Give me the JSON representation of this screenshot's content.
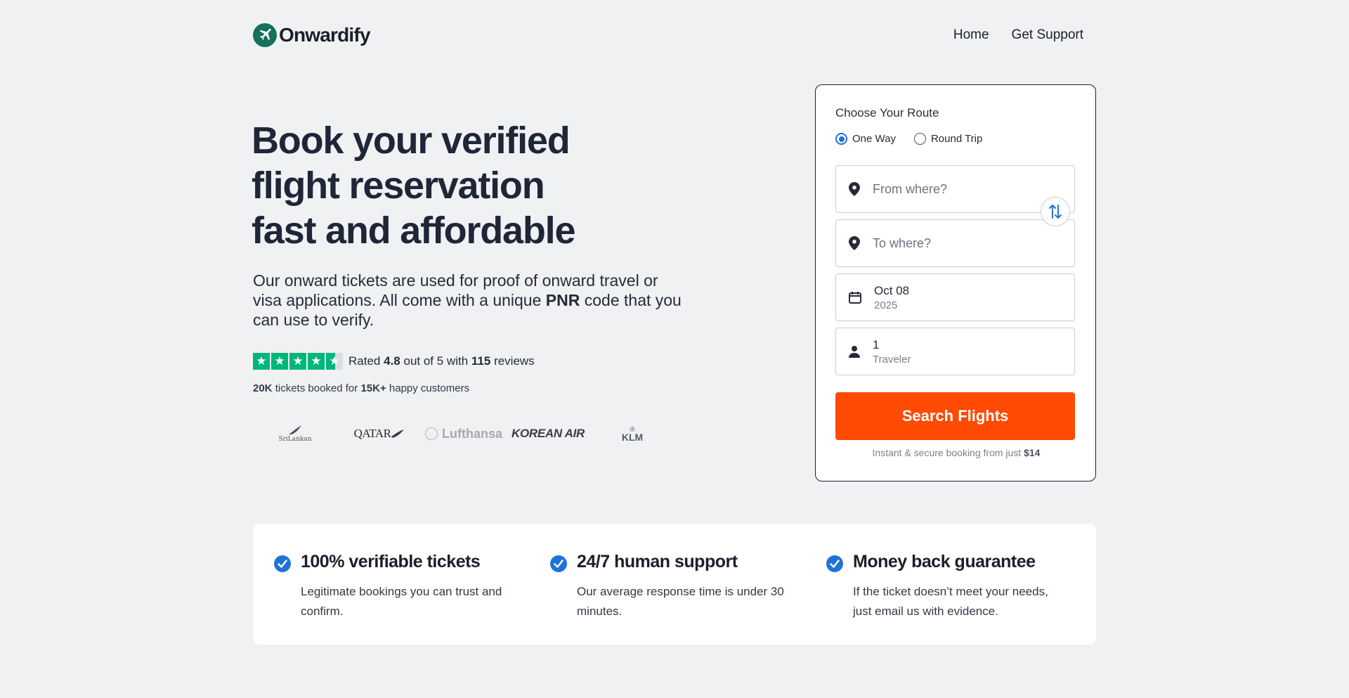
{
  "header": {
    "brand": "Onwardify",
    "nav": [
      {
        "label": "Home"
      },
      {
        "label": "Get Support"
      }
    ]
  },
  "hero": {
    "title_lines": [
      "Book your verified",
      "flight reservation",
      "fast and affordable"
    ],
    "subtitle_pre": "Our onward tickets are used for proof of onward travel or visa applications. All come with a unique ",
    "subtitle_bold": "PNR",
    "subtitle_post": " code that you can use to verify.",
    "rating": {
      "stars": 4.5,
      "prefix": "Rated",
      "score": "4.8",
      "middle": "out of 5 with",
      "count": "115",
      "suffix": "reviews"
    },
    "stats": {
      "tickets": "20K",
      "tickets_text": "tickets booked for",
      "customers": "15K+",
      "customers_text": "happy customers"
    },
    "airlines": [
      "SriLankan",
      "QATAR",
      "Lufthansa",
      "KOREAN AIR",
      "KLM"
    ]
  },
  "booking": {
    "title": "Choose Your Route",
    "trip_types": [
      {
        "label": "One Way",
        "selected": true
      },
      {
        "label": "Round Trip",
        "selected": false
      }
    ],
    "from_placeholder": "From where?",
    "to_placeholder": "To where?",
    "date_value": "Oct 08",
    "date_year": "2025",
    "travelers_value": "1",
    "travelers_label": "Traveler",
    "search_label": "Search Flights",
    "note_text": "Instant & secure booking from just",
    "note_price": "$14"
  },
  "features": [
    {
      "title": "100% verifiable tickets",
      "desc": "Legitimate bookings you can trust and confirm."
    },
    {
      "title": "24/7 human support",
      "desc": "Our average response time is under 30 minutes."
    },
    {
      "title": "Money back guarantee",
      "desc": "If the ticket doesn’t meet your needs, just email us with evidence."
    }
  ],
  "colors": {
    "brand_green": "#14705a",
    "cta_orange": "#ff4a04",
    "accent_blue": "#1f73d8",
    "trustpilot_green": "#00b67a"
  }
}
